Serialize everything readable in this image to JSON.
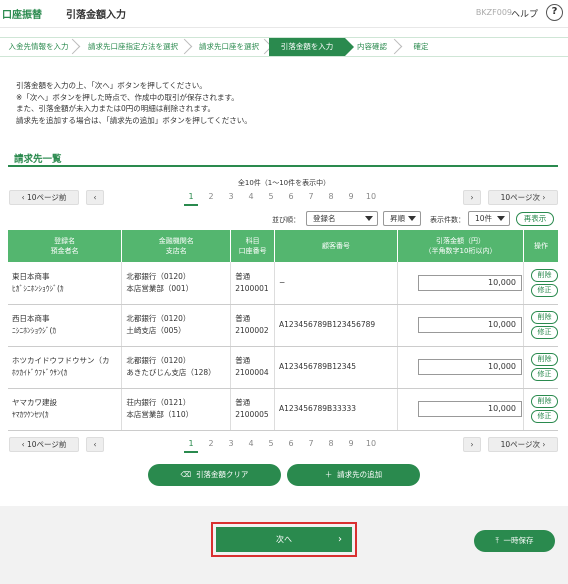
{
  "header": {
    "brand": "口座振替",
    "title": "引落金額入力",
    "screen_code": "BKZF009",
    "help": "ヘルプ"
  },
  "steps": [
    "入金先情報を入力",
    "請求先口座指定方法を選択",
    "請求先口座を選択",
    "引落金額を入力",
    "内容確認",
    "確定"
  ],
  "active_step": 3,
  "instructions": [
    "引落金額を入力の上、「次へ」ボタンを押してください。",
    "※「次へ」ボタンを押した時点で、作成中の取引が保存されます。",
    "また、引落金額が未入力または0円の明細は削除されます。",
    "請求先を追加する場合は、「請求先の追加」ボタンを押してください。"
  ],
  "section_title": "請求先一覧",
  "total_text": "全10件（1〜10件を表示中）",
  "pagination": {
    "prev10": "10ページ前",
    "next10": "10ページ次",
    "pages": [
      "1",
      "2",
      "3",
      "4",
      "5",
      "6",
      "7",
      "8",
      "9",
      "10"
    ],
    "current": "1"
  },
  "sort": {
    "label": "並び順：",
    "field": "登録名",
    "order": "昇順",
    "count_label": "表示件数：",
    "count": "10件",
    "redisplay": "再表示"
  },
  "table": {
    "headers": {
      "name": [
        "登録名",
        "預金者名"
      ],
      "bank": [
        "金融機関名",
        "支店名"
      ],
      "account": [
        "科目",
        "口座番号"
      ],
      "customer": "顧客番号",
      "amount": [
        "引落金額（円）",
        "（半角数字10桁以内）"
      ],
      "ops": "操作"
    },
    "rows": [
      {
        "name": "東日本商事",
        "kana": "ﾋｶﾞｼﾆﾎﾝｼｮｳｼﾞ(ｶ",
        "bank": "北都銀行（0120）",
        "branch": "本店営業部（001）",
        "type": "普通",
        "number": "2100001",
        "customer": "−",
        "amount": "10,000"
      },
      {
        "name": "西日本商事",
        "kana": "ﾆｼﾆﾎﾝｼｮｳｼﾞ(ｶ",
        "bank": "北都銀行（0120）",
        "branch": "土崎支店（005）",
        "type": "普通",
        "number": "2100002",
        "customer": "A123456789B123456789",
        "amount": "10,000"
      },
      {
        "name": "ホツカイドウフドウサン（カ",
        "kana": "ﾎﾂｶｲﾄﾞｳﾌﾄﾞｳｻﾝ(ｶ",
        "bank": "北都銀行（0120）",
        "branch": "あきたびじん支店（128）",
        "type": "普通",
        "number": "2100004",
        "customer": "A123456789B12345",
        "amount": "10,000"
      },
      {
        "name": "ヤマカワ建設",
        "kana": "ﾔﾏｶﾜｹﾝｾﾂ(ｶ",
        "bank": "荘内銀行（0121）",
        "branch": "本店営業部（110）",
        "type": "普通",
        "number": "2100005",
        "customer": "A123456789B33333",
        "amount": "10,000"
      }
    ],
    "delete": "削除",
    "edit": "修正"
  },
  "buttons": {
    "clear": "引落金額クリア",
    "add": "請求先の追加",
    "next": "次へ",
    "save": "一時保存"
  }
}
